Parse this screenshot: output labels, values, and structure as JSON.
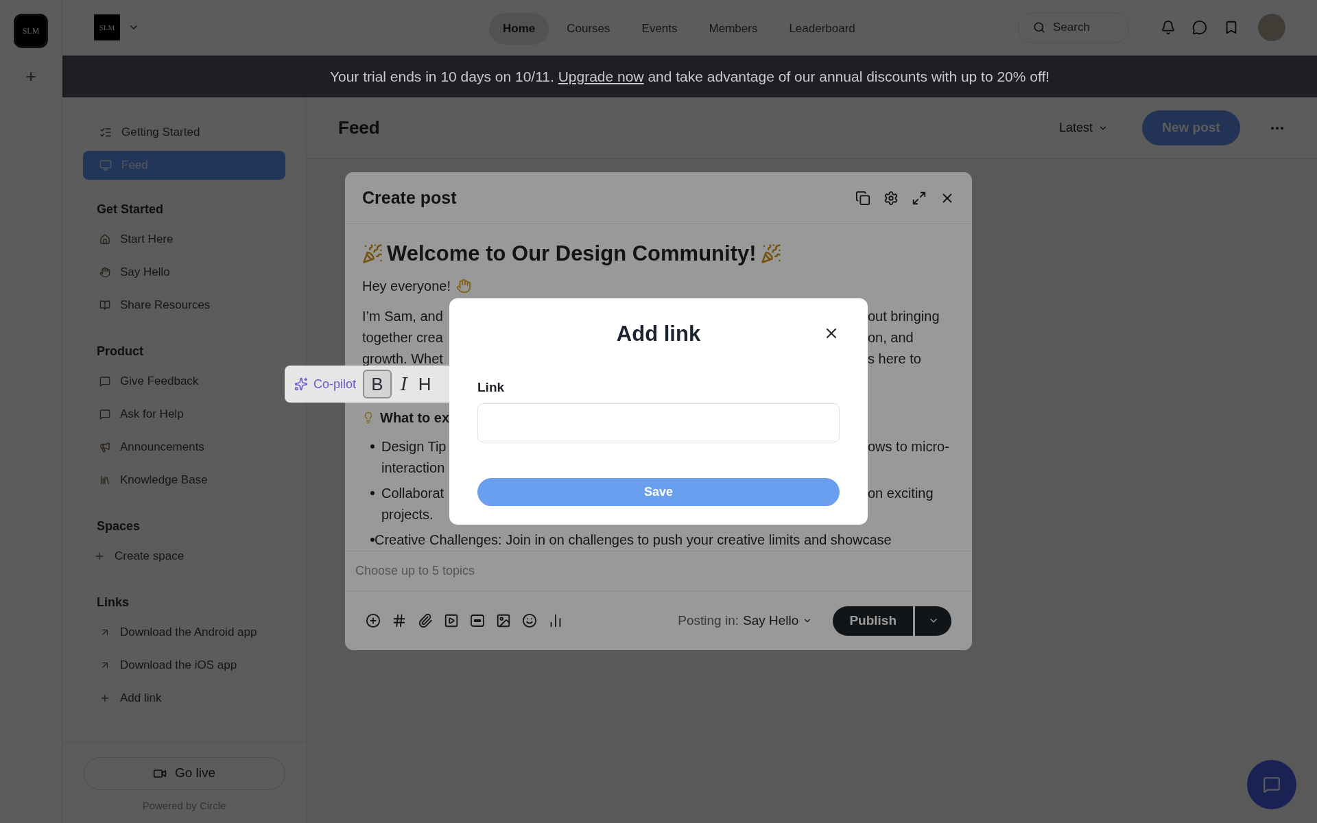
{
  "rail": {
    "logo": "SLM",
    "add": "+"
  },
  "topbar": {
    "logo": "SLM",
    "nav": [
      {
        "label": "Home",
        "selected": true
      },
      {
        "label": "Courses",
        "selected": false
      },
      {
        "label": "Events",
        "selected": false
      },
      {
        "label": "Members",
        "selected": false
      },
      {
        "label": "Leaderboard",
        "selected": false
      }
    ],
    "search": {
      "placeholder": "Search"
    }
  },
  "banner": {
    "before": "Your trial ends in 10 days on 10/11.",
    "link": "Upgrade now",
    "after": "and take advantage of our annual discounts with up to 20% off!"
  },
  "sidebar": {
    "top": [
      {
        "label": "Getting Started",
        "selected": false
      },
      {
        "label": "Feed",
        "selected": true
      }
    ],
    "sections": [
      {
        "title": "Get Started",
        "items": [
          "Start Here",
          "Say Hello",
          "Share Resources"
        ]
      },
      {
        "title": "Product",
        "items": [
          "Give Feedback",
          "Ask for Help",
          "Announcements",
          "Knowledge Base"
        ]
      },
      {
        "title": "Spaces",
        "items": [
          "Create space"
        ]
      },
      {
        "title": "Links",
        "items": [
          "Download the Android app",
          "Download the iOS app",
          "Add link"
        ]
      }
    ],
    "go_live": "Go live",
    "powered_by": "Powered by Circle"
  },
  "feed_header": {
    "title": "Feed",
    "sort": "Latest",
    "new_post": "New post"
  },
  "create_post": {
    "title": "Create post",
    "heading": "Welcome to Our Design Community!",
    "greeting": "Hey everyone!",
    "lines": [
      {
        "left": "I’m Sam, and",
        "right": "out bringing"
      },
      {
        "left": "together crea",
        "right": "on, and"
      },
      {
        "left": "growth. Whet",
        "right": "s here to"
      }
    ],
    "subheading": "What to ex",
    "bullets": [
      {
        "left": "Design Tip",
        "right": "ows to micro-",
        "bullet": true
      },
      {
        "left": "interaction",
        "bullet": false
      },
      {
        "left": "Collaborat",
        "right": "on exciting",
        "bullet": true
      },
      {
        "left": "projects.",
        "bullet": false
      },
      {
        "left": "Creative Challenges: Join in on challenges to push your creative limits and showcase",
        "bullet": true
      }
    ],
    "topics_placeholder": "Choose up to 5 topics",
    "posting_label": "Posting in:",
    "posting_space": "Say Hello",
    "publish": "Publish"
  },
  "copilot": {
    "label": "Co-pilot",
    "formats": [
      {
        "label": "B",
        "kind": "bold",
        "active": true
      },
      {
        "label": "I",
        "kind": "italic",
        "active": false
      },
      {
        "label": "H",
        "kind": "heading",
        "active": false
      }
    ]
  },
  "add_link": {
    "title": "Add link",
    "field_label": "Link",
    "save": "Save"
  }
}
